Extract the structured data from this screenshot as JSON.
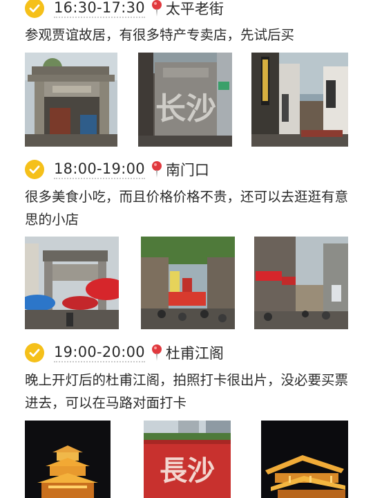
{
  "sections": [
    {
      "time": "16:30-17:30",
      "place": "太平老街",
      "desc": "参观贾谊故居，有很多特产专卖店，先试后买",
      "sign_text": "长沙"
    },
    {
      "time": "18:00-19:00",
      "place": "南门口",
      "desc": "很多美食小吃，而且价格价格不贵，还可以去逛逛有意思的小店"
    },
    {
      "time": "19:00-20:00",
      "place": "杜甫江阁",
      "desc": "晚上开灯后的杜甫江阁，拍照打卡很出片，没必要买票进去，可以在马路对面打卡",
      "sign_text": "長沙"
    }
  ],
  "colors": {
    "check": "#f5c01a",
    "pin": "#e0393e",
    "accent_red": "#c8312e"
  }
}
